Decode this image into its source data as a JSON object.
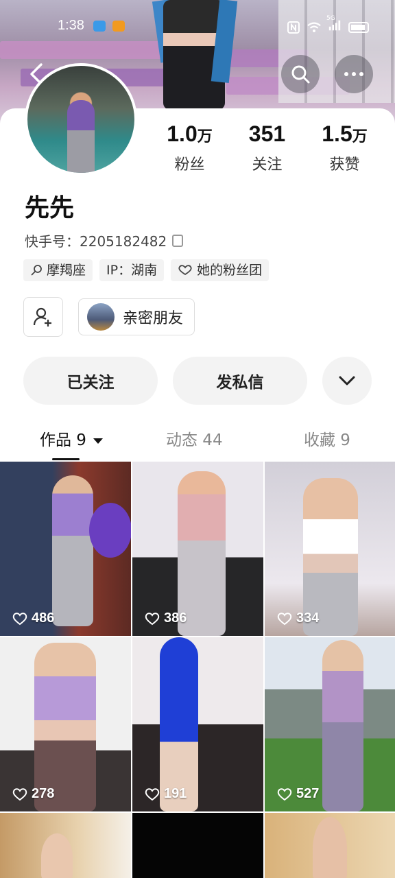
{
  "status_bar": {
    "time": "1:38",
    "network": "5G"
  },
  "header": {
    "back_label": "",
    "search_label": "",
    "more_label": ""
  },
  "profile": {
    "name": "先先",
    "kuaishou_id": "快手号：2205182482",
    "stats": [
      {
        "num": "1.0",
        "unit": "万",
        "label": "粉丝"
      },
      {
        "num": "351",
        "unit": "",
        "label": "关注"
      },
      {
        "num": "1.5",
        "unit": "万",
        "label": "获赞"
      }
    ],
    "tags": [
      "摩羯座",
      "IP：湖南",
      "她的粉丝团"
    ],
    "close_friend_label": "亲密朋友"
  },
  "actions": {
    "follow": "已关注",
    "message": "发私信"
  },
  "tabs": [
    {
      "label": "作品 9",
      "active": true
    },
    {
      "label": "动态 44",
      "active": false
    },
    {
      "label": "收藏 9",
      "active": false
    }
  ],
  "videos": [
    {
      "likes": "486"
    },
    {
      "likes": "386"
    },
    {
      "likes": "334"
    },
    {
      "likes": "278"
    },
    {
      "likes": "191"
    },
    {
      "likes": "527"
    },
    {
      "likes": ""
    },
    {
      "likes": ""
    },
    {
      "likes": ""
    }
  ],
  "colors": {
    "accent_text": "#111111",
    "button_bg": "#f3f3f3"
  }
}
